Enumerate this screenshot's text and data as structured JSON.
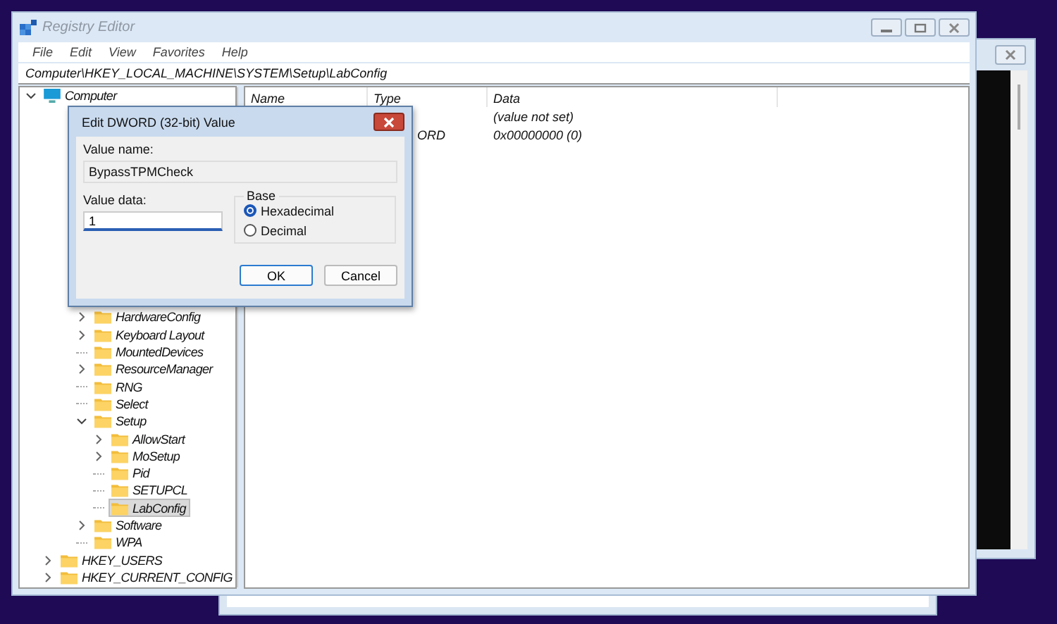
{
  "window": {
    "title": "Registry Editor",
    "active": false
  },
  "menu": [
    "File",
    "Edit",
    "View",
    "Favorites",
    "Help"
  ],
  "address": "Computer\\HKEY_LOCAL_MACHINE\\SYSTEM\\Setup\\LabConfig",
  "tree": {
    "root": {
      "label": "Computer",
      "expanded": true,
      "selected": false
    },
    "branch": [
      {
        "label": "HardwareConfig",
        "expanded": false,
        "selected": false
      },
      {
        "label": "Keyboard Layout",
        "expanded": false,
        "selected": false
      },
      {
        "label": "MountedDevices",
        "selected": false
      },
      {
        "label": "ResourceManager",
        "expanded": false,
        "selected": false
      },
      {
        "label": "RNG",
        "selected": false
      },
      {
        "label": "Select",
        "selected": false
      },
      {
        "label": "Setup",
        "expanded": true,
        "selected": false,
        "children": [
          {
            "label": "AllowStart",
            "expanded": false,
            "selected": false
          },
          {
            "label": "MoSetup",
            "expanded": false,
            "selected": false
          },
          {
            "label": "Pid",
            "selected": false
          },
          {
            "label": "SETUPCL",
            "selected": false
          },
          {
            "label": "LabConfig",
            "selected": true
          }
        ]
      },
      {
        "label": "Software",
        "expanded": false,
        "selected": false
      },
      {
        "label": "WPA",
        "selected": false
      }
    ],
    "hives": [
      {
        "label": "HKEY_USERS",
        "expanded": false,
        "selected": false
      },
      {
        "label": "HKEY_CURRENT_CONFIG",
        "expanded": false,
        "selected": false
      }
    ]
  },
  "values": {
    "columns": [
      "Name",
      "Type",
      "Data"
    ],
    "rows": [
      {
        "data": "(value not set)"
      },
      {
        "type": "ORD",
        "data": "0x00000000 (0)"
      }
    ]
  },
  "dialog": {
    "title": "Edit DWORD (32-bit) Value",
    "value_name_label": "Value name:",
    "value_name": "BypassTPMCheck",
    "value_data_label": "Value data:",
    "value_data": "1",
    "base_label": "Base",
    "base_options": [
      {
        "label": "Hexadecimal",
        "selected": true
      },
      {
        "label": "Decimal",
        "selected": false
      }
    ],
    "buttons": [
      {
        "label": "OK",
        "default": true
      },
      {
        "label": "Cancel",
        "default": false
      }
    ]
  }
}
